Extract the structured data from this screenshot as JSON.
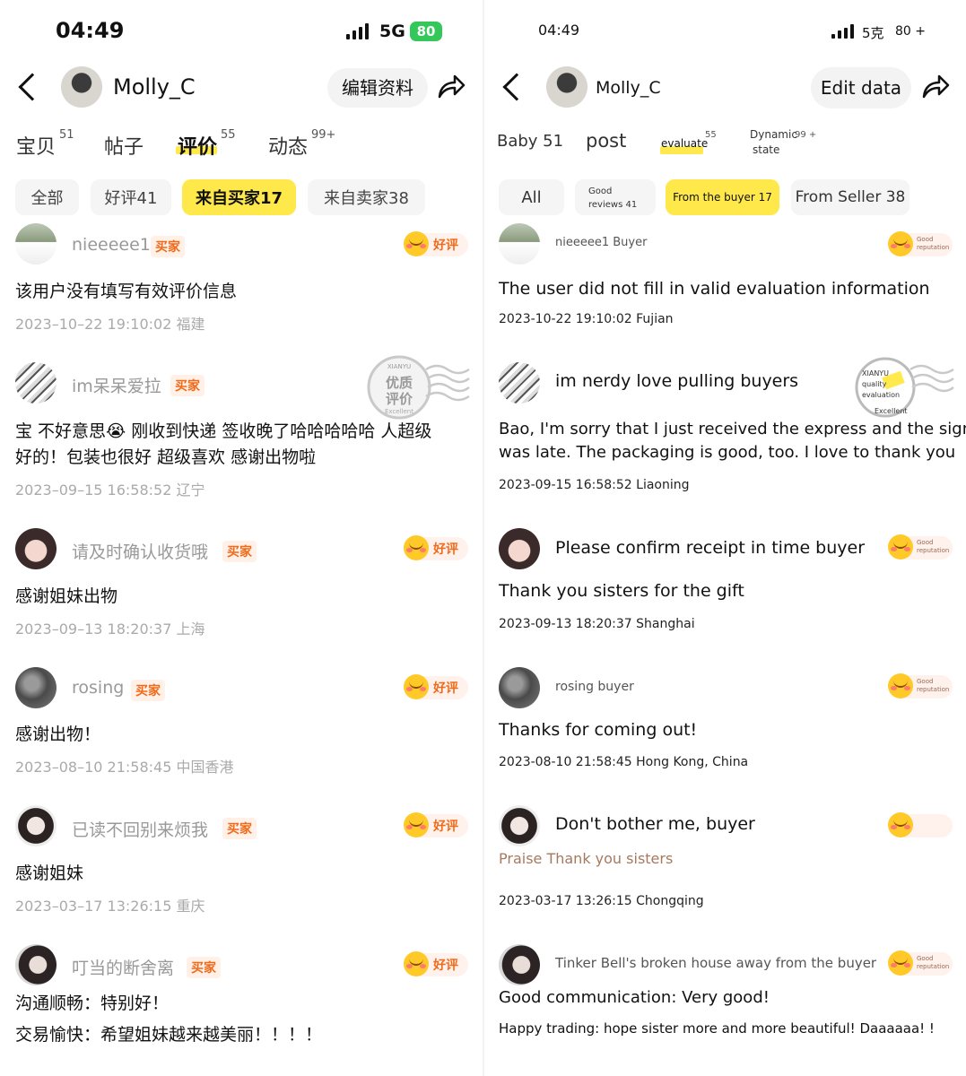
{
  "left": {
    "status": {
      "time": "04:49",
      "network": "5G",
      "battery": "80"
    },
    "header": {
      "username": "Molly_C",
      "edit_label": "编辑资料"
    },
    "tabs": [
      {
        "label": "宝贝",
        "count": "51"
      },
      {
        "label": "帖子",
        "count": ""
      },
      {
        "label": "评价",
        "count": "55"
      },
      {
        "label": "动态",
        "count": "99+"
      }
    ],
    "chips": [
      "全部",
      "好评41",
      "来自买家17",
      "来自卖家38"
    ],
    "buyer_tag": "买家",
    "good_label": "好评",
    "stamp": {
      "top": "XIANYU",
      "main1": "优质",
      "main2": "评价",
      "bottom": "Excellent"
    },
    "reviews": [
      {
        "name": "nieeeee1",
        "text": "该用户没有填写有效评价信息",
        "text2": "",
        "date": "2023–10–22 19:10:02 福建"
      },
      {
        "name": "im呆呆爱拉",
        "text": "宝 不好意思😭 刚收到快递 签收晚了哈哈哈哈哈 人超级",
        "text2": "好的！包装也很好 超级喜欢 感谢出物啦",
        "date": "2023–09–15 16:58:52 辽宁"
      },
      {
        "name": "请及时确认收货哦",
        "text": "感谢姐妹出物",
        "text2": "",
        "date": "2023–09–13 18:20:37 上海"
      },
      {
        "name": "rosing",
        "text": "感谢出物！",
        "text2": "",
        "date": "2023–08–10 21:58:45 中国香港"
      },
      {
        "name": "已读不回别来烦我",
        "text": "感谢姐妹",
        "text2": "",
        "date": "2023–03–17 13:26:15 重庆"
      },
      {
        "name": "叮当的断舍离",
        "text": "沟通顺畅：特别好！",
        "text2": "交易愉快：希望姐妹越来越美丽！！！！",
        "date": ""
      }
    ]
  },
  "right": {
    "status": {
      "time": "04:49",
      "network": "5克",
      "battery": "80 +"
    },
    "header": {
      "username": "Molly_C",
      "edit_label": "Edit data"
    },
    "tabs": [
      {
        "label": "Baby 51",
        "count": ""
      },
      {
        "label": "post",
        "count": ""
      },
      {
        "label": "evaluate",
        "count": "55"
      },
      {
        "label": "Dynamic",
        "count": "99 +",
        "sub": "state"
      }
    ],
    "chips": [
      "All",
      "Good",
      "reviews 41",
      "From the buyer 17",
      "From Seller 38"
    ],
    "good_label": "Good",
    "good_label2": "reputation",
    "stamp": {
      "top": "XIANYU",
      "line1": "quality",
      "line2": "evaluation",
      "bottom": "Excellent"
    },
    "reviews": [
      {
        "name": "nieeeee1 Buyer",
        "text": "The user did not fill in valid evaluation information",
        "text2": "",
        "date": "2023-10-22 19:10:02 Fujian"
      },
      {
        "name": "im nerdy love pulling buyers",
        "text": "Bao, I'm sorry that I just received the express and the signing",
        "text2": "was late. The packaging is good, too. I love to thank you",
        "date": "2023-09-15 16:58:52 Liaoning"
      },
      {
        "name": "Please confirm receipt in time buyer",
        "text": "Thank you sisters for the gift",
        "text2": "",
        "date": "2023-09-13 18:20:37 Shanghai"
      },
      {
        "name": "rosing buyer",
        "text": "Thanks for coming out!",
        "text2": "",
        "date": "2023-08-10 21:58:45 Hong Kong, China"
      },
      {
        "name": "Don't bother me, buyer",
        "text": "Praise Thank you sisters",
        "text2": "",
        "date": "2023-03-17 13:26:15 Chongqing"
      },
      {
        "name": "Tinker Bell's broken house away from the buyer",
        "text": "Good communication: Very good!",
        "text2": "Happy trading: hope sister more and more beautiful! Daaaaaa! !",
        "date": ""
      }
    ]
  }
}
